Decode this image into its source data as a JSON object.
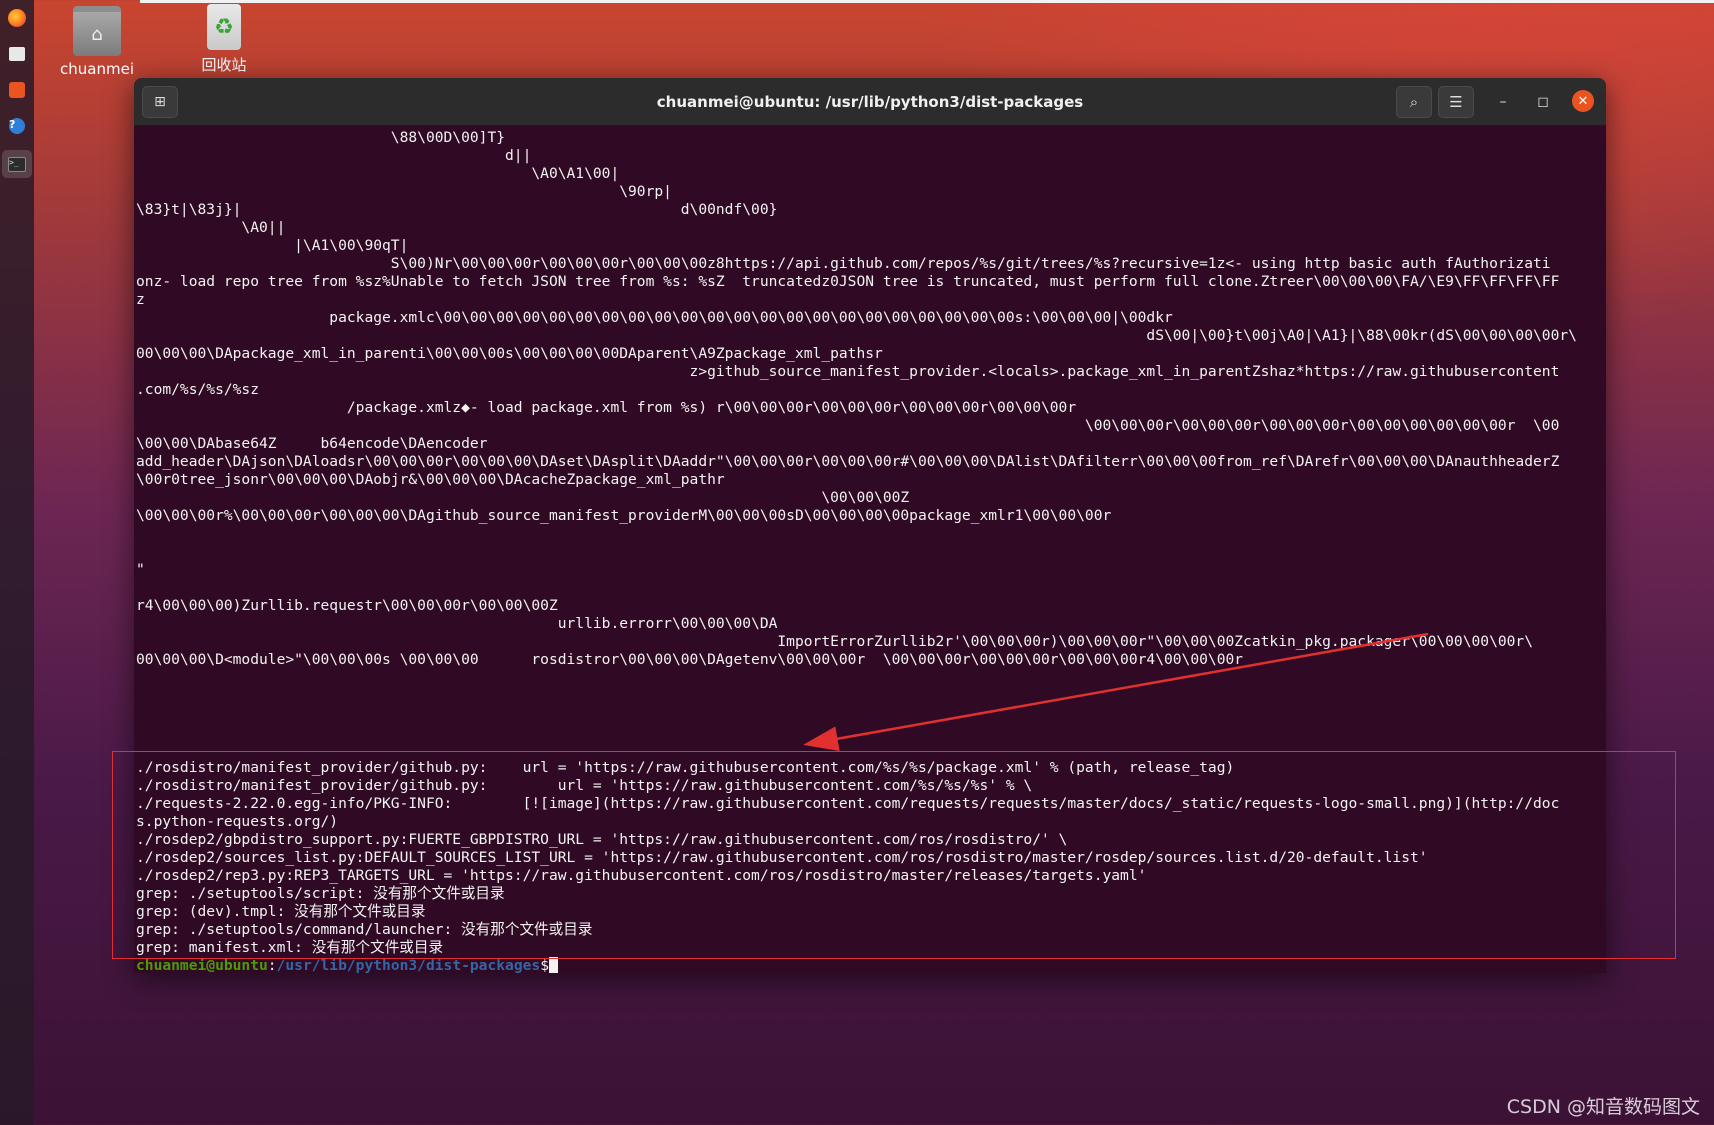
{
  "desktop": {
    "icons": [
      {
        "label": "chuanmei",
        "glyph": "⌂"
      },
      {
        "label": "回收站",
        "glyph": "♻"
      }
    ],
    "dock": [
      "firefox-icon",
      "files-icon",
      "software-icon",
      "help-icon",
      "terminal-icon"
    ],
    "watermark": "CSDN @知音数码图文"
  },
  "terminal": {
    "title": "chuanmei@ubuntu: /usr/lib/python3/dist-packages",
    "buttons": {
      "new_tab": "⊞",
      "search": "⌕",
      "menu": "☰",
      "minimize": "–",
      "maximize": "◻",
      "close": "✕"
    },
    "output_lines": [
      "                             \\88\\00D\\00]T}",
      "                                          d||",
      "                                             \\A0\\A1\\00|",
      "                                                       \\90rp|",
      "\\83}t|\\83j}|                                                  d\\00ndf\\00}",
      "            \\A0||",
      "                  |\\A1\\00\\90qT|",
      "                             S\\00)Nr\\00\\00\\00r\\00\\00\\00r\\00\\00\\00z8https://api.github.com/repos/%s/git/trees/%s?recursive=1z<- using http basic auth fAuthorizati",
      "onz- load repo tree from %sz%Unable to fetch JSON tree from %s: %sZ  truncatedz0JSON tree is truncated, must perform full clone.Ztreer\\00\\00\\00\\FA/\\E9\\FF\\FF\\FF\\FF",
      "z",
      "                      package.xmlc\\00\\00\\00\\00\\00\\00\\00\\00\\00\\00\\00\\00\\00\\00\\00\\00\\00\\00\\00\\00\\00\\00s:\\00\\00\\00|\\00dkr",
      "                                                                                                                   dS\\00|\\00}t\\00j\\A0|\\A1}|\\88\\00kr(dS\\00\\00\\00\\00r\\",
      "00\\00\\00\\DApackage_xml_in_parenti\\00\\00\\00s\\00\\00\\00\\00DAparent\\A9Zpackage_xml_pathsr",
      "                                                               z>github_source_manifest_provider.<locals>.package_xml_in_parentZshaz*https://raw.githubusercontent",
      ".com/%s/%s/%sz",
      "                        /package.xmlz◆- load package.xml from %s) r\\00\\00\\00r\\00\\00\\00r\\00\\00\\00r\\00\\00\\00r",
      "                                                                                                            \\00\\00\\00r\\00\\00\\00r\\00\\00\\00r\\00\\00\\00\\00\\00\\00r  \\00",
      "\\00\\00\\DAbase64Z     b64encode\\DAencoder",
      "add_header\\DAjson\\DAloadsr\\00\\00\\00r\\00\\00\\00\\DAset\\DAsplit\\DAaddr\"\\00\\00\\00r\\00\\00\\00r#\\00\\00\\00\\DAlist\\DAfilterr\\00\\00\\00from_ref\\DArefr\\00\\00\\00\\DAnauthheaderZ",
      "\\00r0tree_jsonr\\00\\00\\00\\DAobjr&\\00\\00\\00\\DAcacheZpackage_xml_pathr",
      "                                                                              \\00\\00\\00Z",
      "\\00\\00\\00r%\\00\\00\\00r\\00\\00\\00\\DAgithub_source_manifest_providerM\\00\\00\\00sD\\00\\00\\00\\00package_xmlr1\\00\\00\\00r",
      "",
      "",
      "\"",
      "",
      "r4\\00\\00\\00)Zurllib.requestr\\00\\00\\00r\\00\\00\\00Z",
      "                                                urllib.errorr\\00\\00\\00\\DA",
      "                                                                         ImportErrorZurllib2r'\\00\\00\\00r)\\00\\00\\00r\"\\00\\00\\00Zcatkin_pkg.packager\\00\\00\\00\\00r\\",
      "00\\00\\00\\D<module>\"\\00\\00\\00s \\00\\00\\00      rosdistror\\00\\00\\00\\DAgetenv\\00\\00\\00r  \\00\\00\\00r\\00\\00\\00r\\00\\00\\00r4\\00\\00\\00r",
      "",
      "",
      "",
      "",
      "",
      "./rosdistro/manifest_provider/github.py:    url = 'https://raw.githubusercontent.com/%s/%s/package.xml' % (path, release_tag)",
      "./rosdistro/manifest_provider/github.py:        url = 'https://raw.githubusercontent.com/%s/%s/%s' % \\",
      "./requests-2.22.0.egg-info/PKG-INFO:        [![image](https://raw.githubusercontent.com/requests/requests/master/docs/_static/requests-logo-small.png)](http://doc",
      "s.python-requests.org/)",
      "./rosdep2/gbpdistro_support.py:FUERTE_GBPDISTRO_URL = 'https://raw.githubusercontent.com/ros/rosdistro/' \\",
      "./rosdep2/sources_list.py:DEFAULT_SOURCES_LIST_URL = 'https://raw.githubusercontent.com/ros/rosdistro/master/rosdep/sources.list.d/20-default.list'",
      "./rosdep2/rep3.py:REP3_TARGETS_URL = 'https://raw.githubusercontent.com/ros/rosdistro/master/releases/targets.yaml'",
      "grep: ./setuptools/script: 没有那个文件或目录",
      "grep: (dev).tmpl: 没有那个文件或目录",
      "grep: ./setuptools/command/launcher: 没有那个文件或目录",
      "grep: manifest.xml: 没有那个文件或目录"
    ],
    "prompt": {
      "user": "chuanmei@ubuntu",
      "path": "/usr/lib/python3/dist-packages",
      "symbol": "$"
    }
  },
  "colors": {
    "terminal_bg": "#300a24",
    "prompt_user": "#4e9a06",
    "prompt_path": "#3465a4",
    "annotation": "#e03030",
    "close_button": "#e95420"
  }
}
